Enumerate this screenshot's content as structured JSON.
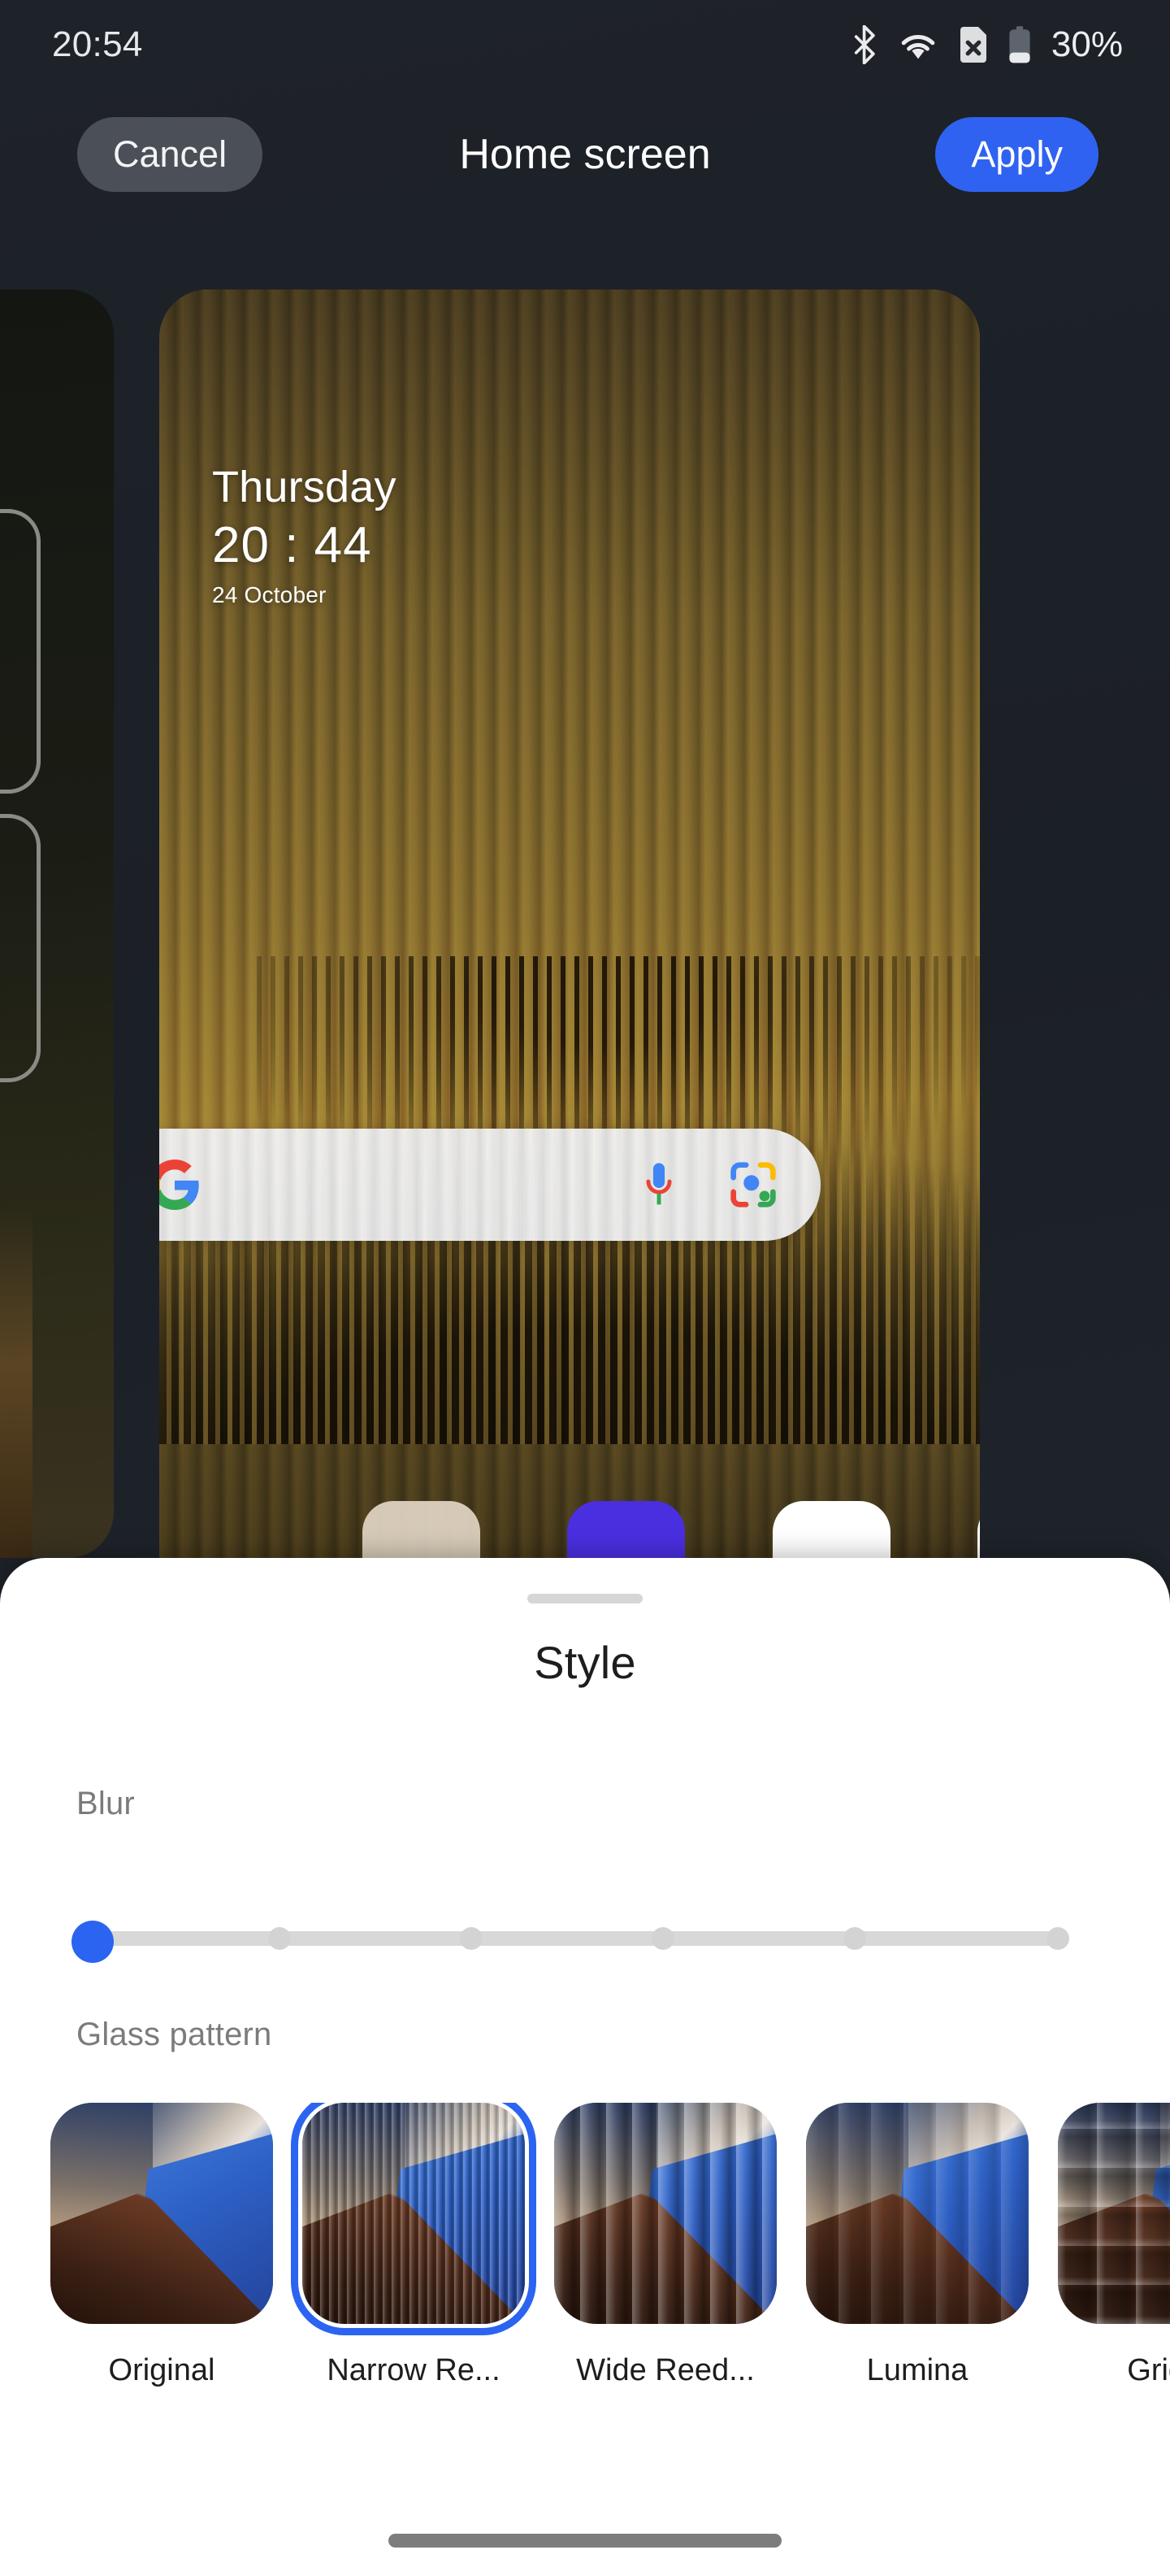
{
  "status_bar": {
    "time": "20:54",
    "battery_percent": "30%",
    "icons": [
      "bluetooth-icon",
      "wifi-icon",
      "sim-card-off-icon",
      "battery-icon"
    ]
  },
  "top_bar": {
    "cancel_label": "Cancel",
    "title": "Home screen",
    "apply_label": "Apply"
  },
  "preview": {
    "clock_widget": {
      "day": "Thursday",
      "time": "20 : 44",
      "date": "24 October"
    },
    "search_bar": {
      "google_logo": "google-g-icon",
      "mic": "microphone-icon",
      "lens": "google-lens-icon"
    }
  },
  "sheet": {
    "title": "Style",
    "blur": {
      "label": "Blur",
      "value": 0,
      "steps": 5
    },
    "glass_pattern": {
      "label": "Glass pattern",
      "selected_index": 1,
      "options": [
        {
          "label": "Original",
          "style": "original"
        },
        {
          "label": "Narrow Re...",
          "style": "narrow"
        },
        {
          "label": "Wide Reed...",
          "style": "wide"
        },
        {
          "label": "Lumina",
          "style": "lumina"
        },
        {
          "label": "Grid...",
          "style": "grid"
        }
      ]
    }
  },
  "colors": {
    "accent_blue": "#2b64f0",
    "apply_blue": "#2f62f0",
    "sheet_bg": "#ffffff",
    "app_bg": "#1e2229",
    "cancel_bg": "#4b5058"
  },
  "nav_bar": {
    "gesture_pill": "home-gesture-pill"
  }
}
